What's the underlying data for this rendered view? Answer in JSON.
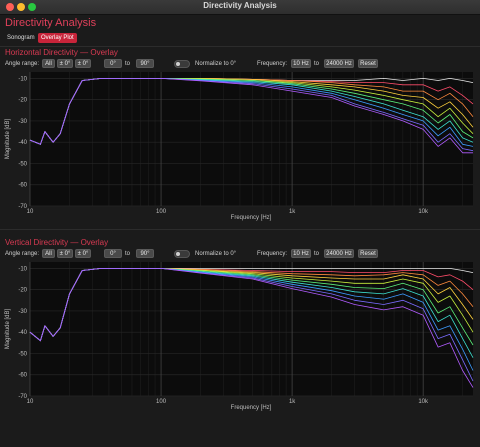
{
  "window": {
    "title": "Directivity Analysis"
  },
  "app": {
    "title": "Directivity Analysis"
  },
  "tabs": [
    {
      "label": "Sonogram",
      "active": false
    },
    {
      "label": "Overlay Plot",
      "active": true
    }
  ],
  "sections": [
    {
      "title": "Horizontal Directivity — Overlay",
      "controls": {
        "angle_range_label": "Angle range:",
        "buttons": [
          "All",
          "± 0°",
          "± 0°"
        ],
        "angle_from": "0°",
        "to_label": "to",
        "angle_to": "90°",
        "normalize_label": "Normalize to 0°",
        "frequency_label": "Frequency:",
        "freq_from": "10 Hz",
        "freq_to": "24000 Hz",
        "reset_label": "Reset"
      },
      "plot": {
        "ylabel": "Magnitude [dB]",
        "xlabel": "Frequency [Hz]",
        "yticks": [
          "-10",
          "-20",
          "-30",
          "-40",
          "-50",
          "-60",
          "-70"
        ],
        "xticks": [
          "10",
          "100",
          "1k",
          "10k"
        ]
      }
    },
    {
      "title": "Vertical Directivity — Overlay",
      "controls": {
        "angle_range_label": "Angle range:",
        "buttons": [
          "All",
          "± 0°",
          "± 0°"
        ],
        "angle_from": "0°",
        "to_label": "to",
        "angle_to": "90°",
        "normalize_label": "Normalize to 0°",
        "frequency_label": "Frequency:",
        "freq_from": "10 Hz",
        "freq_to": "24000 Hz",
        "reset_label": "Reset"
      },
      "plot": {
        "ylabel": "Magnitude [dB]",
        "xlabel": "Frequency [Hz]",
        "yticks": [
          "-10",
          "-20",
          "-30",
          "-40",
          "-50",
          "-60",
          "-70"
        ],
        "xticks": [
          "10",
          "100",
          "1k",
          "10k"
        ]
      }
    }
  ],
  "colors": {
    "accent": "#c8243a",
    "section_title": "#d83a52",
    "curves": [
      "#e8e8e8",
      "#ff4d6a",
      "#ff8a3d",
      "#ffd23d",
      "#c8f03d",
      "#5cf07a",
      "#3de0d0",
      "#3d9cff",
      "#7a6cff",
      "#b15cff",
      "#ff5cd6"
    ]
  },
  "chart_data": [
    {
      "type": "line",
      "title": "Horizontal Directivity — Overlay",
      "xlabel": "Frequency [Hz]",
      "ylabel": "Magnitude [dB]",
      "x_scale": "log",
      "xlim": [
        10,
        24000
      ],
      "ylim": [
        -70,
        -7
      ],
      "grid": true,
      "x": [
        10,
        12,
        13,
        15,
        17,
        20,
        25,
        35,
        50,
        100,
        200,
        500,
        1000,
        2000,
        3000,
        5000,
        7000,
        10000,
        13000,
        16000,
        20000,
        24000
      ],
      "series": [
        {
          "values": [
            -39,
            -41,
            -35,
            -40,
            -36,
            -22,
            -11,
            -10,
            -10,
            -10,
            -10,
            -10.5,
            -11,
            -11,
            -11,
            -10,
            -11,
            -10,
            -11,
            -10,
            -11,
            -12
          ]
        },
        {
          "values": [
            -39,
            -41,
            -35,
            -40,
            -36,
            -22,
            -11,
            -10,
            -10,
            -10,
            -10,
            -10.5,
            -11,
            -11.5,
            -12,
            -12,
            -13,
            -13,
            -16,
            -14,
            -18,
            -22
          ]
        },
        {
          "values": [
            -39,
            -41,
            -35,
            -40,
            -36,
            -22,
            -11,
            -10,
            -10,
            -10,
            -10,
            -10.5,
            -11,
            -12,
            -13,
            -14,
            -16,
            -16,
            -20,
            -17,
            -22,
            -28
          ]
        },
        {
          "values": [
            -39,
            -41,
            -35,
            -40,
            -36,
            -22,
            -11,
            -10,
            -10,
            -10,
            -10,
            -10.5,
            -11.5,
            -13,
            -14,
            -16,
            -18,
            -19,
            -24,
            -21,
            -27,
            -33
          ]
        },
        {
          "values": [
            -39,
            -41,
            -35,
            -40,
            -36,
            -22,
            -11,
            -10,
            -10,
            -10,
            -10.2,
            -11,
            -12,
            -14,
            -15.5,
            -18,
            -20,
            -22,
            -28,
            -24,
            -31,
            -36
          ]
        },
        {
          "values": [
            -39,
            -41,
            -35,
            -40,
            -36,
            -22,
            -11,
            -10,
            -10,
            -10,
            -10.4,
            -11,
            -12.5,
            -15,
            -17,
            -20,
            -22,
            -25,
            -31,
            -27,
            -35,
            -38
          ]
        },
        {
          "values": [
            -39,
            -41,
            -35,
            -40,
            -36,
            -22,
            -11,
            -10,
            -10,
            -10,
            -10.6,
            -11.5,
            -13,
            -16,
            -18.5,
            -22,
            -25,
            -28,
            -34,
            -30,
            -38,
            -40
          ]
        },
        {
          "values": [
            -39,
            -41,
            -35,
            -40,
            -36,
            -22,
            -11,
            -10,
            -10,
            -10,
            -10.8,
            -12,
            -14,
            -17,
            -20,
            -24,
            -27,
            -30,
            -37,
            -33,
            -41,
            -42
          ]
        },
        {
          "values": [
            -39,
            -41,
            -35,
            -40,
            -36,
            -22,
            -11,
            -10,
            -10,
            -10,
            -11,
            -12.5,
            -15,
            -18,
            -22,
            -26,
            -29,
            -32,
            -40,
            -36,
            -43,
            -44
          ]
        },
        {
          "values": [
            -39,
            -41,
            -35,
            -40,
            -36,
            -22,
            -11,
            -10,
            -10,
            -10,
            -11.2,
            -13,
            -16,
            -19,
            -23,
            -27,
            -30,
            -34,
            -42,
            -38,
            -45,
            -45
          ]
        }
      ]
    },
    {
      "type": "line",
      "title": "Vertical Directivity — Overlay",
      "xlabel": "Frequency [Hz]",
      "ylabel": "Magnitude [dB]",
      "x_scale": "log",
      "xlim": [
        10,
        24000
      ],
      "ylim": [
        -70,
        -7
      ],
      "grid": true,
      "x": [
        10,
        12,
        13,
        15,
        17,
        20,
        25,
        35,
        50,
        100,
        200,
        500,
        1000,
        2000,
        3000,
        5000,
        7000,
        10000,
        13000,
        16000,
        20000,
        24000
      ],
      "series": [
        {
          "values": [
            -40,
            -44,
            -37,
            -42,
            -38,
            -22,
            -11,
            -10,
            -10,
            -10,
            -10,
            -10,
            -10,
            -10,
            -10,
            -10,
            -10,
            -10,
            -10,
            -10,
            -11,
            -12
          ]
        },
        {
          "values": [
            -40,
            -44,
            -37,
            -42,
            -38,
            -22,
            -11,
            -10,
            -10,
            -10,
            -10.5,
            -11,
            -11.5,
            -11.5,
            -12,
            -12,
            -11,
            -11,
            -14,
            -13,
            -16,
            -20
          ]
        },
        {
          "values": [
            -40,
            -44,
            -37,
            -42,
            -38,
            -22,
            -11,
            -10,
            -10,
            -10,
            -10.5,
            -11.5,
            -12.5,
            -13,
            -13.5,
            -13,
            -12,
            -13,
            -18,
            -16,
            -22,
            -28
          ]
        },
        {
          "values": [
            -40,
            -44,
            -37,
            -42,
            -38,
            -22,
            -11,
            -10,
            -10,
            -10,
            -10.8,
            -12,
            -13.5,
            -14.5,
            -15,
            -15,
            -13,
            -15,
            -22,
            -19,
            -27,
            -34
          ]
        },
        {
          "values": [
            -40,
            -44,
            -37,
            -42,
            -38,
            -22,
            -11,
            -10,
            -10,
            -10,
            -11,
            -12.5,
            -14.5,
            -16,
            -17,
            -17,
            -15,
            -17,
            -26,
            -23,
            -32,
            -40
          ]
        },
        {
          "values": [
            -40,
            -44,
            -37,
            -42,
            -38,
            -22,
            -11,
            -10,
            -10,
            -10,
            -11.2,
            -13,
            -15.5,
            -17.5,
            -19,
            -19.5,
            -17,
            -20,
            -31,
            -28,
            -38,
            -46
          ]
        },
        {
          "values": [
            -40,
            -44,
            -37,
            -42,
            -38,
            -22,
            -11,
            -10,
            -10,
            -10,
            -11.5,
            -13.5,
            -16.5,
            -19,
            -21,
            -22,
            -19.5,
            -23,
            -35,
            -32,
            -43,
            -52
          ]
        },
        {
          "values": [
            -40,
            -44,
            -37,
            -42,
            -38,
            -22,
            -11,
            -10,
            -10,
            -10,
            -11.8,
            -14,
            -17.5,
            -20.5,
            -23,
            -24.5,
            -22,
            -26,
            -39,
            -37,
            -48,
            -58
          ]
        },
        {
          "values": [
            -40,
            -44,
            -37,
            -42,
            -38,
            -22,
            -11,
            -10,
            -10,
            -10,
            -12,
            -14.5,
            -18.5,
            -22,
            -25,
            -27,
            -25,
            -29,
            -43,
            -41,
            -53,
            -63
          ]
        },
        {
          "values": [
            -40,
            -44,
            -37,
            -42,
            -38,
            -22,
            -11,
            -10,
            -10,
            -10,
            -12.2,
            -15,
            -19.5,
            -23.5,
            -27,
            -29.5,
            -28,
            -32,
            -47,
            -45,
            -58,
            -66
          ]
        }
      ]
    }
  ]
}
